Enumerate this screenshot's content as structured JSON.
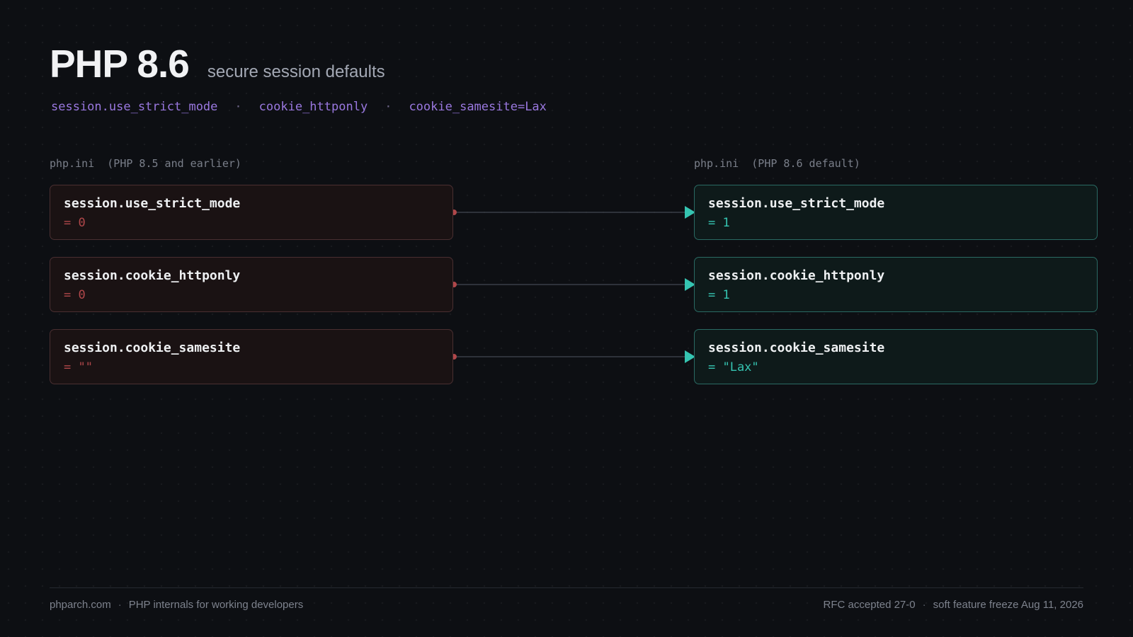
{
  "header": {
    "title": "PHP 8.6",
    "subtitle": "secure session defaults"
  },
  "tags": [
    "session.use_strict_mode",
    "cookie_httponly",
    "cookie_samesite=Lax"
  ],
  "tag_separator": "·",
  "columns": {
    "left_label": "php.ini  (PHP 8.5 and earlier)",
    "right_label": "php.ini  (PHP 8.6 default)"
  },
  "settings": [
    {
      "key": "session.use_strict_mode",
      "old_value": "= 0",
      "new_value": "= 1"
    },
    {
      "key": "session.cookie_httponly",
      "old_value": "= 0",
      "new_value": "= 1"
    },
    {
      "key": "session.cookie_samesite",
      "old_value": "= \"\"",
      "new_value": "= \"Lax\""
    }
  ],
  "footer": {
    "site": "phparch.com",
    "tagline": "PHP internals for working developers",
    "rfc": "RFC accepted 27-0",
    "freeze": "soft feature freeze Aug 11, 2026",
    "separator": "·"
  },
  "colors": {
    "old_accent": "#b0474a",
    "new_accent": "#35c4b1",
    "tag_accent": "#9a78e0",
    "connector": "#3a3f47"
  }
}
